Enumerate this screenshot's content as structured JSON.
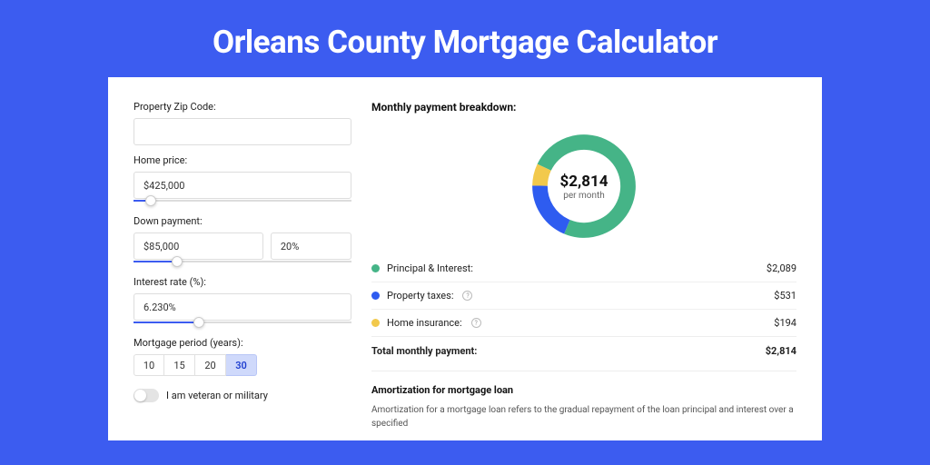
{
  "page": {
    "title": "Orleans County Mortgage Calculator"
  },
  "form": {
    "zip": {
      "label": "Property Zip Code:",
      "value": ""
    },
    "home_price": {
      "label": "Home price:",
      "value": "$425,000",
      "slider_pct": 8
    },
    "down_payment": {
      "label": "Down payment:",
      "amount": "$85,000",
      "percent": "20%",
      "slider_pct": 20
    },
    "interest": {
      "label": "Interest rate (%):",
      "value": "6.230%",
      "slider_pct": 30
    },
    "period": {
      "label": "Mortgage period (years):",
      "options": [
        "10",
        "15",
        "20",
        "30"
      ],
      "active_index": 3
    },
    "veteran": {
      "label": "I am veteran or military",
      "checked": false
    }
  },
  "breakdown": {
    "title": "Monthly payment breakdown:",
    "center_value": "$2,814",
    "center_sub": "per month",
    "rows": [
      {
        "label": "Principal & Interest:",
        "value": "$2,089",
        "color": "#45b487",
        "info": false
      },
      {
        "label": "Property taxes:",
        "value": "$531",
        "color": "#2e5cf0",
        "info": true
      },
      {
        "label": "Home insurance:",
        "value": "$194",
        "color": "#f2c94c",
        "info": true
      }
    ],
    "total": {
      "label": "Total monthly payment:",
      "value": "$2,814"
    }
  },
  "chart_data": {
    "type": "pie",
    "title": "Monthly payment breakdown",
    "series": [
      {
        "name": "Principal & Interest",
        "value": 2089,
        "color": "#45b487"
      },
      {
        "name": "Property taxes",
        "value": 531,
        "color": "#2e5cf0"
      },
      {
        "name": "Home insurance",
        "value": 194,
        "color": "#f2c94c"
      }
    ],
    "total": 2814,
    "center_label": "$2,814 per month"
  },
  "amortization": {
    "title": "Amortization for mortgage loan",
    "text": "Amortization for a mortgage loan refers to the gradual repayment of the loan principal and interest over a specified"
  }
}
